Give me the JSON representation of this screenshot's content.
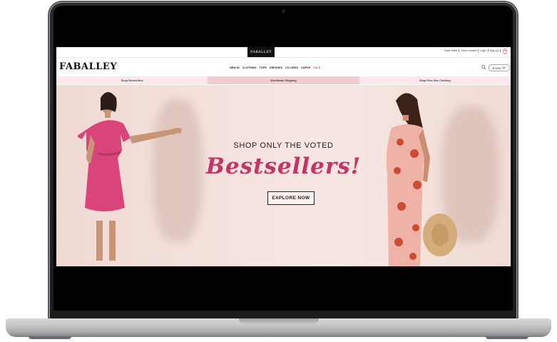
{
  "store": {
    "brand": "FABALLEY",
    "logo_tab": "FABALLEY"
  },
  "utility_links": [
    "Track Order",
    "Store Locator",
    "Login",
    "Sign up"
  ],
  "nav": {
    "items": [
      "NEW IN",
      "CLOTHING",
      "TOPS",
      "DRESSES",
      "CO-ORDS",
      "CURVE"
    ],
    "sale": "SALE"
  },
  "currency": {
    "value": "$ USD"
  },
  "promo_strip": [
    "Shop Bestsellers",
    "Worldwide Shipping",
    "Shop Plus Size Clothing"
  ],
  "hero": {
    "eyebrow": "SHOP ONLY THE VOTED",
    "script": "Bestsellers!",
    "cta": "EXPLORE NOW"
  },
  "colors": {
    "accent": "#c53467",
    "sale": "#e0457b",
    "promo_bg": "#fbe8ea",
    "promo_mid_bg": "#f1cdd1",
    "hero_bg": "#f5e3df"
  },
  "icons": [
    "search-icon",
    "cart-icon",
    "chevron-down-icon",
    "camera-icon"
  ]
}
